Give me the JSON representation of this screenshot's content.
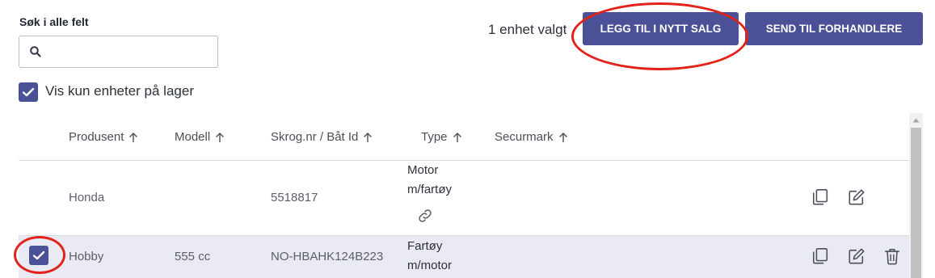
{
  "search": {
    "label": "Søk i alle felt",
    "value": "",
    "placeholder": ""
  },
  "filter": {
    "stock_only_label": "Vis kun enheter på lager",
    "stock_only_checked": true
  },
  "toolbar": {
    "selected_count_text": "1 enhet valgt",
    "add_to_sale_label": "LEGG TIL I NYTT SALG",
    "send_to_dealers_label": "SEND TIL FORHANDLERE"
  },
  "table": {
    "columns": [
      {
        "label": "Produsent"
      },
      {
        "label": "Modell"
      },
      {
        "label": "Skrog.nr / Båt Id"
      },
      {
        "label": "Type"
      },
      {
        "label": "Securmark"
      }
    ],
    "rows": [
      {
        "selected": false,
        "produsent": "Honda",
        "modell": "",
        "skrog": "5518817",
        "type_line1": "Motor",
        "type_line2": "m/fartøy",
        "securmark": "",
        "has_link": true
      },
      {
        "selected": true,
        "produsent": "Hobby",
        "modell": "555 cc",
        "skrog": "NO-HBAHK124B223",
        "type_line1": "Fartøy",
        "type_line2": "m/motor",
        "securmark": "",
        "has_delete": true
      }
    ]
  },
  "colors": {
    "accent": "#4a5196",
    "highlight_ellipse": "#e2231a",
    "selected_row_bg": "#e9eaf3"
  },
  "icons": {
    "search": "search-icon",
    "sort": "arrow-up-icon",
    "link": "link-icon",
    "copy": "copy-icon",
    "edit": "edit-icon",
    "delete": "trash-icon",
    "check": "checkmark-icon"
  }
}
